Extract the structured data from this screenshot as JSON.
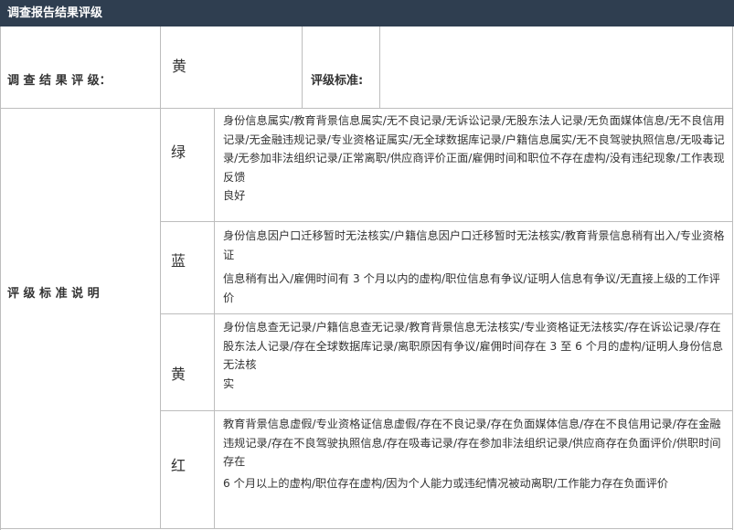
{
  "header": {
    "title": "调查报告结果评级"
  },
  "result_row": {
    "label": "调 查  结 果 评 级：",
    "grade": "黄",
    "standard_label": "评级标准:",
    "standard_value": ""
  },
  "standards": {
    "label": "评 级  标 准 说 明",
    "grades": [
      {
        "name": "绿",
        "lines": [
          "身份信息属实/教育背景信息属实/无不良记录/无诉讼记录/无股东法人记录/无负面媒体信息/无不良信用记录/无金融违规记录/专业资格证属实/无全球数据库记录/户籍信息属实/无不良驾驶执照信息/无吸毒记录/无参加非法组织记录/正常离职/供应商评价正面/雇佣时间和职位不存在虚构/没有违纪现象/工作表现反馈",
          "良好"
        ]
      },
      {
        "name": "蓝",
        "lines": [
          "身份信息因户口迁移暂时无法核实/户籍信息因户口迁移暂时无法核实/教育背景信息稍有出入/专业资格证",
          "信息稍有出入/雇佣时间有 3 个月以内的虚构/职位信息有争议/证明人信息有争议/无直接上级的工作评价"
        ]
      },
      {
        "name": "黄",
        "lines": [
          "身份信息查无记录/户籍信息查无记录/教育背景信息无法核实/专业资格证无法核实/存在诉讼记录/存在股东法人记录/存在全球数据库记录/离职原因有争议/雇佣时间存在 3 至 6 个月的虚构/证明人身份信息无法核",
          "实"
        ]
      },
      {
        "name": "红",
        "lines": [
          "教育背景信息虚假/专业资格证信息虚假/存在不良记录/存在负面媒体信息/存在不良信用记录/存在金融违规记录/存在不良驾驶执照信息/存在吸毒记录/存在参加非法组织记录/供应商存在负面评价/供职时间存在",
          "6 个月以上的虚构/职位存在虚构/因为个人能力或违纪情况被动离职/工作能力存在负面评价"
        ]
      }
    ]
  }
}
